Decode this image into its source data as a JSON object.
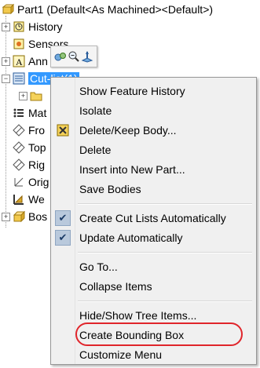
{
  "tree": {
    "root_label": "Part1  (Default<As Machined><Default>)",
    "items": [
      {
        "label": "History"
      },
      {
        "label": "Sensors"
      },
      {
        "label": "Ann"
      },
      {
        "label": "Cut-list(1)"
      },
      {
        "label": ""
      },
      {
        "label": "Mat"
      },
      {
        "label": "Fro"
      },
      {
        "label": "Top"
      },
      {
        "label": "Rig"
      },
      {
        "label": "Orig"
      },
      {
        "label": "We"
      },
      {
        "label": "Bos"
      }
    ]
  },
  "menu": {
    "items": [
      {
        "label": "Show Feature History"
      },
      {
        "label": "Isolate"
      },
      {
        "label": "Delete/Keep Body..."
      },
      {
        "label": "Delete"
      },
      {
        "label": "Insert into New Part..."
      },
      {
        "label": "Save Bodies"
      },
      {
        "label": "Create Cut Lists Automatically"
      },
      {
        "label": "Update Automatically"
      },
      {
        "label": "Go To..."
      },
      {
        "label": "Collapse Items"
      },
      {
        "label": "Hide/Show Tree Items..."
      },
      {
        "label": "Create Bounding Box"
      },
      {
        "label": "Customize Menu"
      }
    ]
  },
  "colors": {
    "selection": "#3399ff",
    "highlight_oval": "#e0252b",
    "menu_bg": "#f0f0f0"
  },
  "icons": {
    "minibar": [
      "appearance-icon",
      "zoom-to-selection-icon",
      "coordinate-axes-icon"
    ]
  }
}
